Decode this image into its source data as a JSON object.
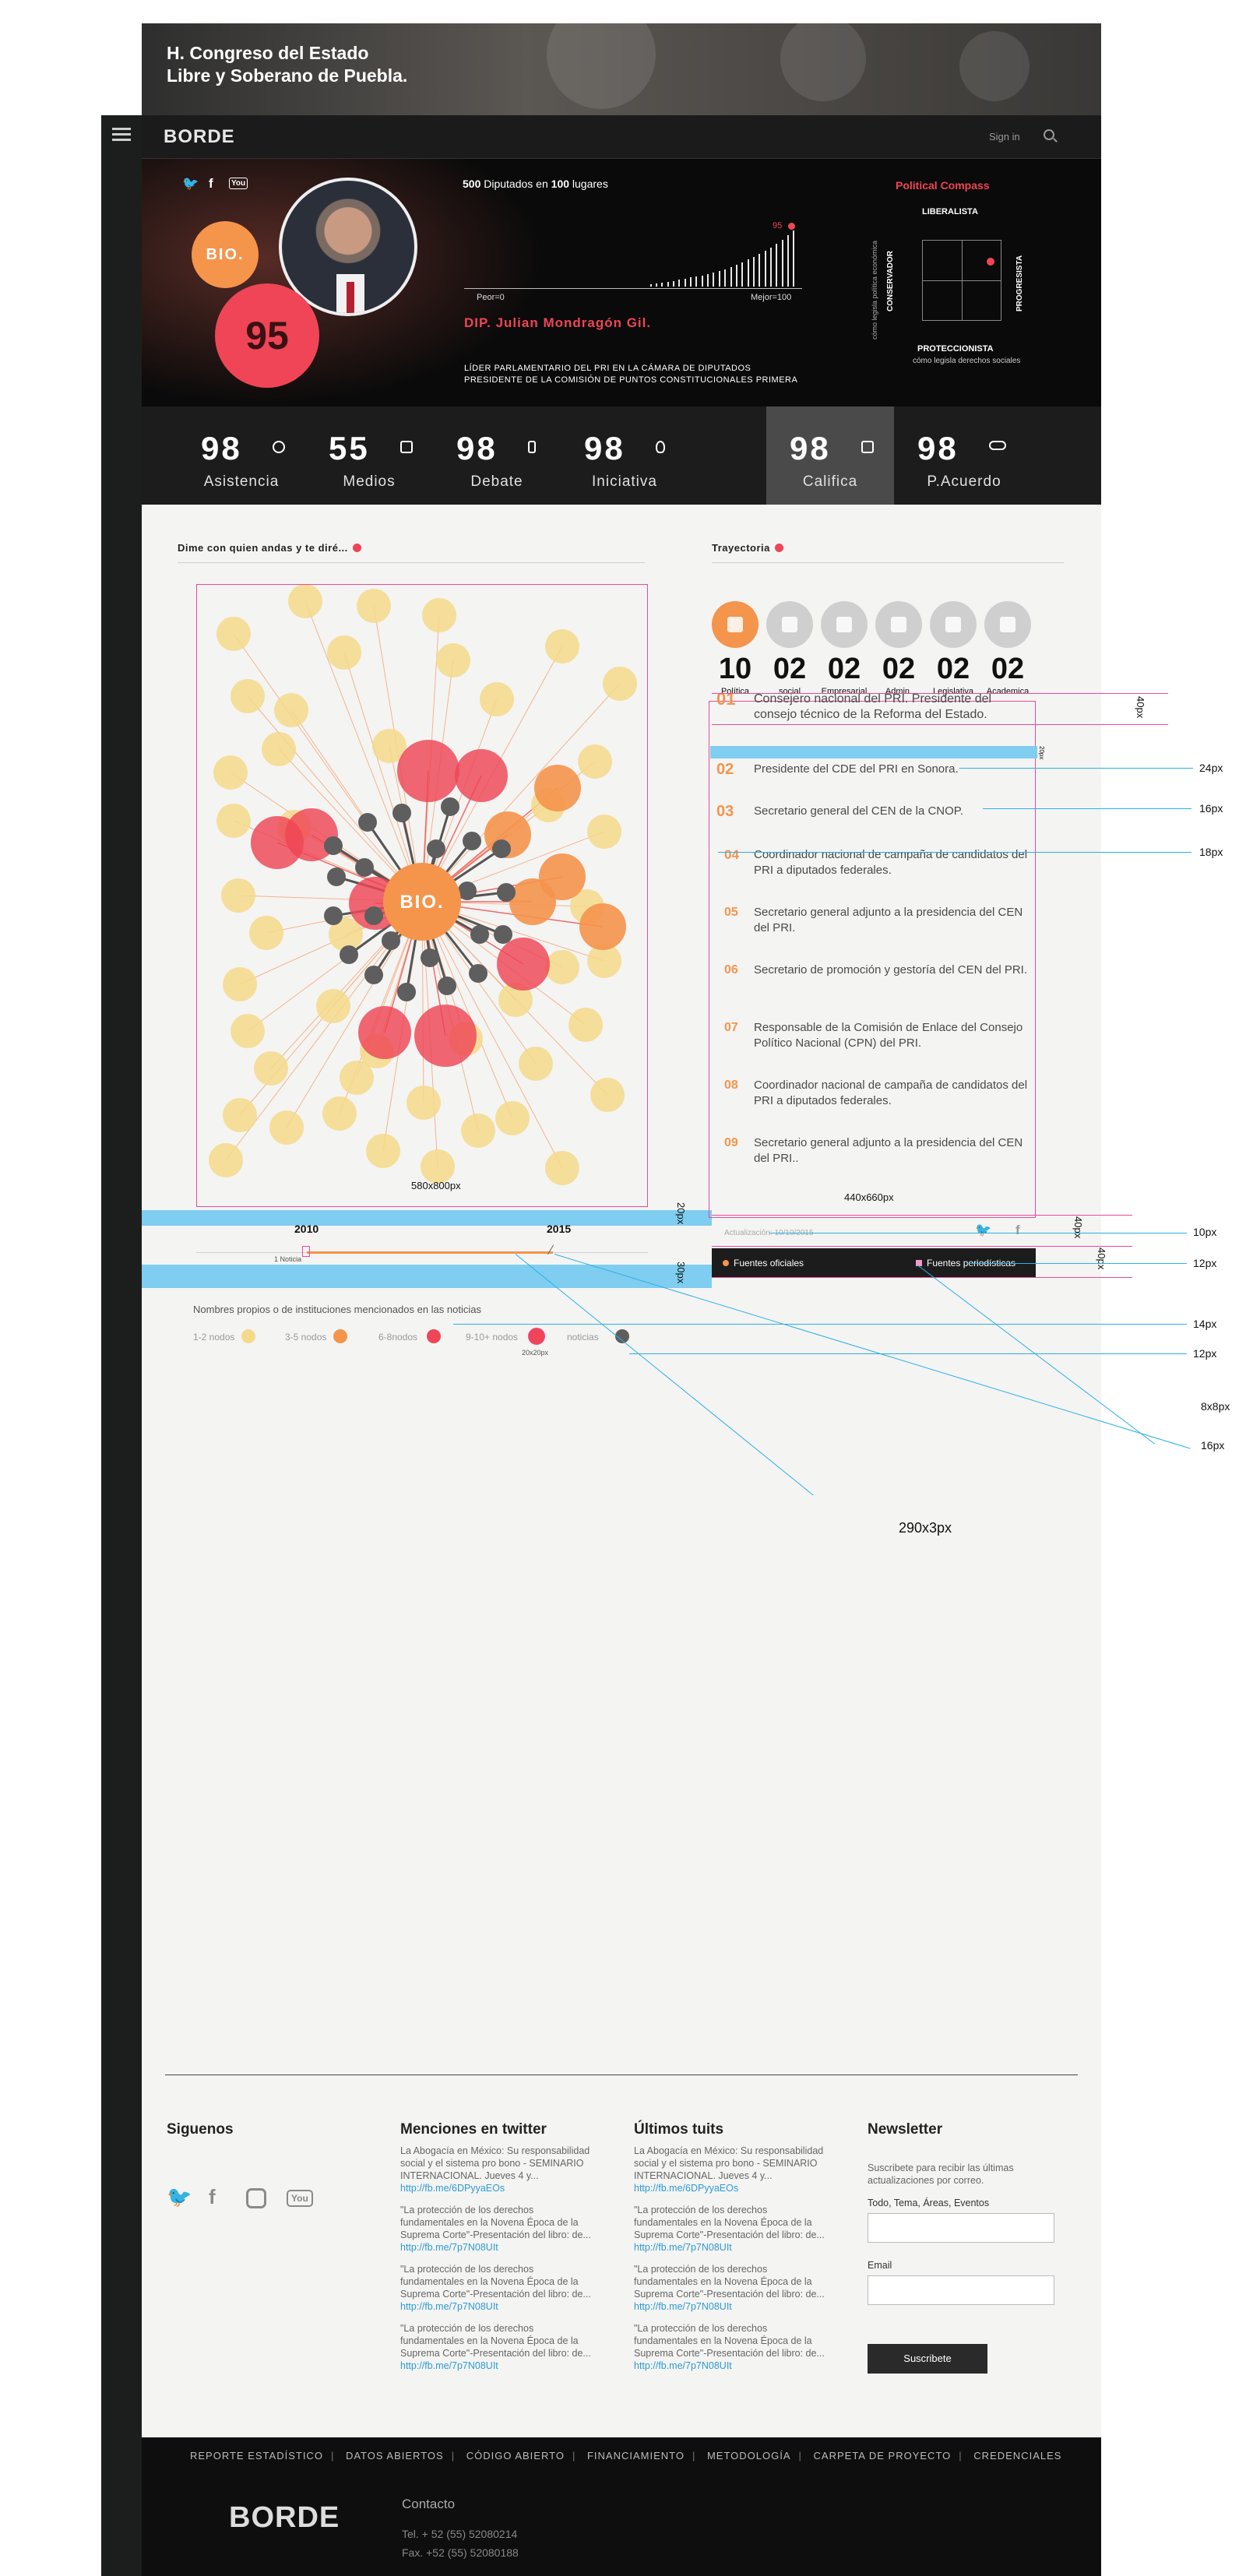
{
  "banner": {
    "title": "H. Congreso del Estado\nLibre y Soberano de Puebla."
  },
  "nav": {
    "logo": "BORDE",
    "signin": "Sign in"
  },
  "profile": {
    "bio_badge": "BIO.",
    "score": "95",
    "diputados_count": "500",
    "diputados_text": " Diputados en ",
    "places_count": "100",
    "places_text": " lugares",
    "marker_value": "95",
    "worst_label": "Peor=0",
    "best_label": "Mejor=100",
    "name": "DIP. Julian Mondragón Gil.",
    "role_line1": "LÍDER PARLAMENTARIO DEL PRI EN LA CÁMARA DE DIPUTADOS",
    "role_line2": "PRESIDENTE DE LA COMISIÓN DE PUNTOS CONSTITUCIONALES PRIMERA",
    "histogram_heights": [
      3,
      4,
      5,
      6,
      7,
      9,
      10,
      12,
      13,
      14,
      16,
      18,
      20,
      22,
      25,
      28,
      31,
      35,
      38,
      42,
      46,
      50,
      55,
      60,
      66,
      72
    ],
    "marker_position": 0.95
  },
  "compass": {
    "title": "Political Compass",
    "top": "LIBERALISTA",
    "bottom": "PROTECCIONISTA",
    "bottom_sub": "cómo legisla derechos sociales",
    "left_sub": "cómo legisla política económica",
    "left": "CONSERVADOR",
    "right": "PROGRESISTA",
    "dot_x": 0.82,
    "dot_y": 0.25
  },
  "stats": [
    {
      "num": "98",
      "label": "Asistencia",
      "icon": "clock-icon"
    },
    {
      "num": "55",
      "label": "Medios",
      "icon": "newspaper-icon"
    },
    {
      "num": "98",
      "label": "Debate",
      "icon": "speaker-icon"
    },
    {
      "num": "98",
      "label": "Iniciativa",
      "icon": "lightbulb-icon"
    },
    {
      "num": "98",
      "label": "Califica",
      "icon": "checklist-icon"
    },
    {
      "num": "98",
      "label": "P.Acuerdo",
      "icon": "handshake-icon"
    }
  ],
  "network": {
    "title": "Dime con quien andas y te diré...",
    "center_label": "BIO.",
    "dimension": "580x800px",
    "timeline": {
      "start": "2010",
      "end": "2015",
      "note": "1 Noticia"
    },
    "legend_title": "Nombres propios o de instituciones mencionados en las noticias",
    "legend": [
      {
        "label": "1-2 nodos",
        "color": "#f5d98a"
      },
      {
        "label": "3-5 nodos",
        "color": "#f5944b"
      },
      {
        "label": "6-8nodos",
        "color": "#ef4556"
      },
      {
        "label": "9-10+ nodos",
        "color": "#ef4556"
      },
      {
        "label": "noticias",
        "color": "#5e5e5e"
      }
    ],
    "legend_note": "20x20px"
  },
  "trayectoria": {
    "title": "Trayectoria",
    "categories": [
      {
        "num": "10",
        "label": "Política",
        "icon": "building-icon"
      },
      {
        "num": "02",
        "label": "social",
        "icon": "hand-icon"
      },
      {
        "num": "02",
        "label": "Empresarial",
        "icon": "money-icon"
      },
      {
        "num": "02",
        "label": "Admin.",
        "icon": "folder-icon"
      },
      {
        "num": "02",
        "label": "Legislativa",
        "icon": "document-icon"
      },
      {
        "num": "02",
        "label": "Academica",
        "icon": "graduate-icon"
      }
    ],
    "items": [
      {
        "idx": "01",
        "text": "Consejero nacional del PRI. Presidente del consejo técnico de la Reforma del Estado."
      },
      {
        "idx": "02",
        "text": "Presidente del CDE del PRI en Sonora."
      },
      {
        "idx": "03",
        "text": "Secretario general del CEN de la CNOP."
      },
      {
        "idx": "04",
        "text": "Coordinador nacional de campaña de candidatos del PRI a diputados federales."
      },
      {
        "idx": "05",
        "text": "Secretario general adjunto a la presidencia del CEN del PRI."
      },
      {
        "idx": "06",
        "text": "Secretario de promoción y gestoría del CEN del PRI."
      },
      {
        "idx": "07",
        "text": "Responsable de la Comisión de Enlace del Consejo Político Nacional (CPN) del PRI."
      },
      {
        "idx": "08",
        "text": "Coordinador nacional de campaña de candidatos del PRI a diputados federales."
      },
      {
        "idx": "09",
        "text": "Secretario general adjunto a la presidencia del CEN del PRI.."
      }
    ],
    "dimension": "440x660px",
    "update": "Actualización: 10/10/2015",
    "fuentes_oficiales": "Fuentes oficiales",
    "fuentes_periodisticas": "Fuentes periodísticas"
  },
  "annotations": {
    "a24": "24px",
    "a16a": "16px",
    "a18": "18px",
    "a40a": "40px",
    "a20a": "20px",
    "a10": "10px",
    "a12a": "12px",
    "a40b": "40px",
    "a40c": "40px",
    "a20b": "20px",
    "a30": "30px",
    "a14": "14px",
    "a12b": "12px",
    "a8": "8x8px",
    "a16b": "16px",
    "a290": "290x3px"
  },
  "footer": {
    "siguenos": "Siguenos",
    "menciones_title": "Menciones en twitter",
    "tuits_title": "Últimos tuits",
    "newsletter_title": "Newsletter",
    "tweet1": "La Abogacía en México: Su responsabilidad social y el sistema pro bono - SEMINARIO INTERNACIONAL. Jueves 4 y... ",
    "tweet1_link": "http://fb.me/6DPyyaEOs",
    "tweet2": "\"La protección de los derechos fundamentales en la Novena Época de la Suprema Corte\"-Presentación del libro: de... ",
    "tweet2_link": "http://fb.me/7p7N08UIt",
    "newsletter_text": "Suscribete para recibir las últimas actualizaciones por correo.",
    "newsletter_topics": "Todo, Tema, Áreas, Eventos",
    "newsletter_email": "Email",
    "subscribe": "Suscribete",
    "links": [
      "REPORTE ESTADÍSTICO",
      "DATOS ABIERTOS",
      "CÓDIGO ABIERTO",
      "FINANCIAMIENTO",
      "METODOLOGÍA",
      "CARPETA DE PROYECTO",
      "CREDENCIALES"
    ],
    "logo": "BORDE",
    "contacto": "Contacto",
    "tel": "Tel. + 52 (55) 52080214",
    "fax": "Fax. +52 (55) 52080188"
  }
}
